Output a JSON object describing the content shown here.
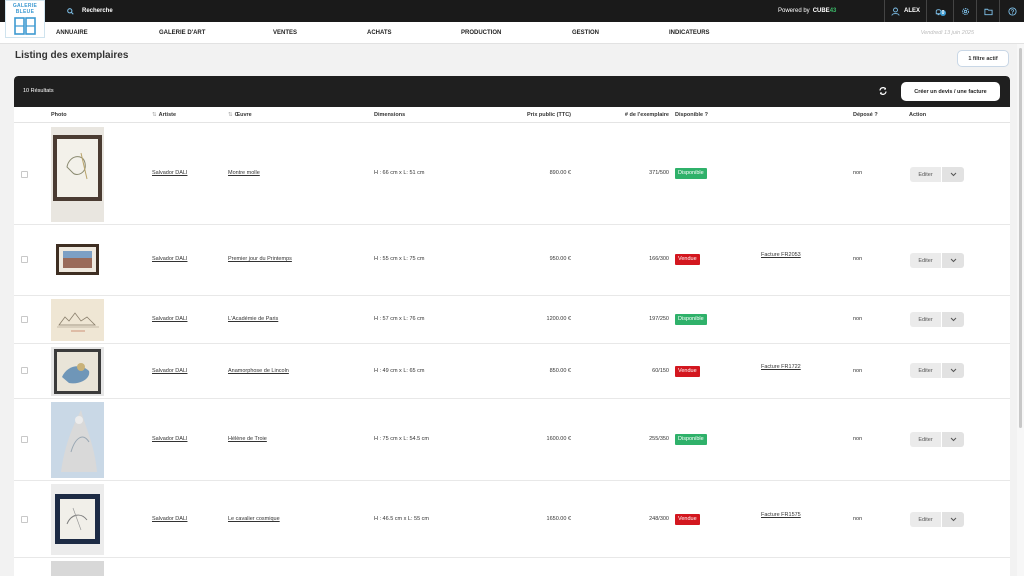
{
  "brand": {
    "logo_text": "GALERIE BLEUE",
    "accent": "#3d9ad1"
  },
  "topbar": {
    "search_label": "Recherche",
    "powered_prefix": "Powered by",
    "powered_brand": "CUBE",
    "powered_brand_suffix": "43",
    "user": "ALEX",
    "notif_count": "0"
  },
  "nav": {
    "items": [
      "ANNUAIRE",
      "GALERIE D'ART",
      "VENTES",
      "ACHATS",
      "PRODUCTION",
      "GESTION",
      "INDICATEURS"
    ],
    "date": "Vendredi 13 juin 2025"
  },
  "page": {
    "title": "Listing des exemplaires",
    "filter_button": "1 filtre actif"
  },
  "table": {
    "count_label": "10 Résultats",
    "create_button": "Créer un devis / une facture",
    "headers": {
      "photo": "Photo",
      "artist": "Artiste",
      "work": "Œuvre",
      "dimensions": "Dimensions",
      "price": "Prix public (TTC)",
      "copy": "# de l'exemplaire",
      "available": "Disponible ?",
      "deposited": "Déposé ?",
      "action": "Action"
    },
    "edit_label": "Editer",
    "rows": [
      {
        "artist": "Salvador DALI",
        "work": "Montre molle",
        "dims": "H : 66 cm x L: 51 cm",
        "price": "890.00 €",
        "copy": "371/500",
        "status": "Disponible",
        "status_color": "#2fb16a",
        "invoice": "",
        "deposited": "non"
      },
      {
        "artist": "Salvador DALI",
        "work": "Premier jour du Printemps",
        "dims": "H : 55 cm x L: 75 cm",
        "price": "950.00 €",
        "copy": "166/300",
        "status": "Vendue",
        "status_color": "#d3171f",
        "invoice": "Facture FR2053",
        "deposited": "non"
      },
      {
        "artist": "Salvador DALI",
        "work": "L'Académie de Paris",
        "dims": "H : 57 cm x L: 76 cm",
        "price": "1200.00 €",
        "copy": "197/250",
        "status": "Disponible",
        "status_color": "#2fb16a",
        "invoice": "",
        "deposited": "non"
      },
      {
        "artist": "Salvador DALI",
        "work": "Anamorphose de Lincoln",
        "dims": "H : 49 cm x L: 65 cm",
        "price": "850.00 €",
        "copy": "60/150",
        "status": "Vendue",
        "status_color": "#d3171f",
        "invoice": "Facture FR1722",
        "deposited": "non"
      },
      {
        "artist": "Salvador DALI",
        "work": "Hélène de Troie",
        "dims": "H : 75 cm x L: 54.5 cm",
        "price": "1600.00 €",
        "copy": "255/350",
        "status": "Disponible",
        "status_color": "#2fb16a",
        "invoice": "",
        "deposited": "non"
      },
      {
        "artist": "Salvador DALI",
        "work": "Le cavalier cosmique",
        "dims": "H : 46.5 cm x L: 55 cm",
        "price": "1650.00 €",
        "copy": "248/300",
        "status": "Vendue",
        "status_color": "#d3171f",
        "invoice": "Facture FR1575",
        "deposited": "non"
      }
    ]
  }
}
